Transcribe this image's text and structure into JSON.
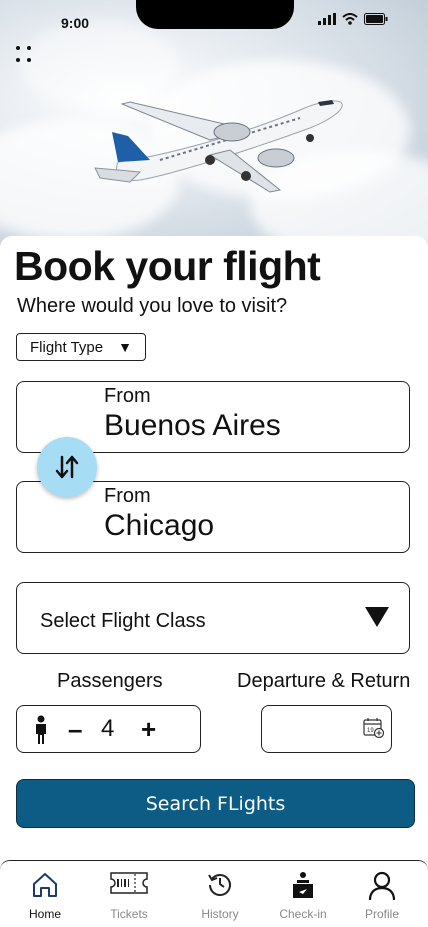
{
  "status": {
    "time": "9:00"
  },
  "header": {
    "title": "Book your flight",
    "subtitle": "Where would you love to visit?"
  },
  "flight_type": {
    "label": "Flight Type"
  },
  "origin": {
    "label": "From",
    "value": "Buenos Aires"
  },
  "destination": {
    "label": "From",
    "value": "Chicago"
  },
  "flight_class": {
    "placeholder": "Select Flight Class"
  },
  "passengers": {
    "label": "Passengers",
    "count": "4",
    "minus": "–",
    "plus": "+"
  },
  "dates": {
    "label": "Departure & Return"
  },
  "search": {
    "label": "Search FLights"
  },
  "tabbar": {
    "items": [
      {
        "label": "Home",
        "icon": "home-icon",
        "active": true
      },
      {
        "label": "Tickets",
        "icon": "ticket-icon",
        "active": false
      },
      {
        "label": "History",
        "icon": "history-icon",
        "active": false
      },
      {
        "label": "Check-in",
        "icon": "check-in-icon",
        "active": false
      },
      {
        "label": "Profile",
        "icon": "profile-icon",
        "active": false
      }
    ]
  },
  "colors": {
    "accent": "#0c5c85",
    "swap_button": "#a7dcf5"
  }
}
